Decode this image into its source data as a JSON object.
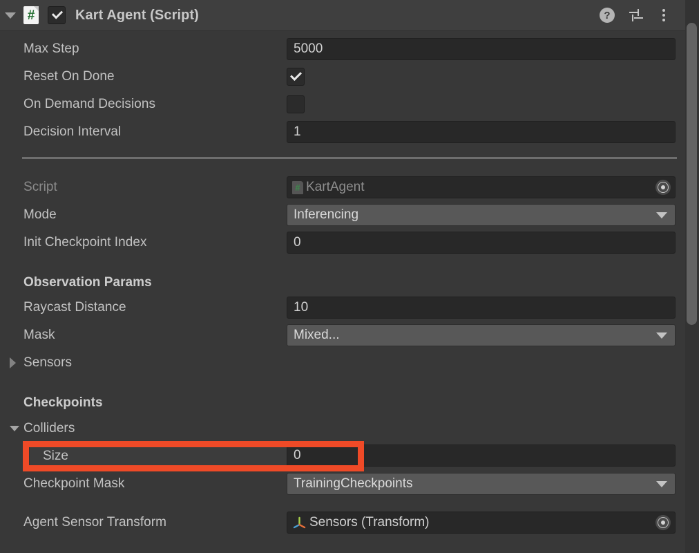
{
  "header": {
    "title": "Kart Agent (Script)",
    "foldout_icon": "triangle-down-icon",
    "script_icon": "csharp-script-icon",
    "script_icon_glyph": "#",
    "enabled": true,
    "help_icon": "help-icon",
    "help_glyph": "?",
    "preset_icon": "preset-sliders-icon",
    "menu_icon": "kebab-menu-icon"
  },
  "rows": {
    "max_step": {
      "label": "Max Step",
      "value": "5000"
    },
    "reset_on_done": {
      "label": "Reset On Done",
      "checked": true
    },
    "on_demand_decisions": {
      "label": "On Demand Decisions",
      "checked": false
    },
    "decision_interval": {
      "label": "Decision Interval",
      "value": "1"
    },
    "script": {
      "label": "Script",
      "value": "KartAgent",
      "icon": "csharp-script-icon",
      "icon_glyph": "#",
      "picker_icon": "object-picker-icon"
    },
    "mode": {
      "label": "Mode",
      "value": "Inferencing",
      "arrow_icon": "chevron-down-icon"
    },
    "init_checkpoint_index": {
      "label": "Init Checkpoint Index",
      "value": "0"
    },
    "observation_params_header": {
      "label": "Observation Params"
    },
    "raycast_distance": {
      "label": "Raycast Distance",
      "value": "10"
    },
    "mask": {
      "label": "Mask",
      "value": "Mixed...",
      "arrow_icon": "chevron-down-icon"
    },
    "sensors": {
      "label": "Sensors",
      "expanded": false,
      "foldout_icon": "triangle-right-icon"
    },
    "checkpoints_header": {
      "label": "Checkpoints"
    },
    "colliders": {
      "label": "Colliders",
      "expanded": true,
      "foldout_icon": "triangle-down-icon"
    },
    "size": {
      "label": "Size",
      "value": "0",
      "highlighted": true
    },
    "checkpoint_mask": {
      "label": "Checkpoint Mask",
      "value": "TrainingCheckpoints",
      "arrow_icon": "chevron-down-icon"
    },
    "agent_sensor_transform": {
      "label": "Agent Sensor Transform",
      "value": "Sensors (Transform)",
      "icon": "transform-gizmo-icon",
      "picker_icon": "object-picker-icon"
    }
  },
  "colors": {
    "panel_bg": "#383838",
    "header_bg": "#3f3f3f",
    "input_bg": "#282828",
    "dropdown_bg": "#585858",
    "label_text": "#c2c2c2",
    "dim_text": "#8b8b8b",
    "highlight": "#ef4a27",
    "scrollbar_thumb": "#636363"
  },
  "scrollbar": {
    "name": "vertical-scrollbar"
  }
}
